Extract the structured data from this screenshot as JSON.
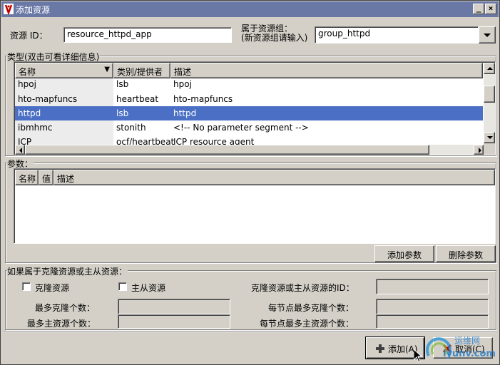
{
  "window": {
    "title": "添加资源",
    "min_glyph": "_",
    "max_glyph": "□",
    "close_glyph": "×",
    "title_bg": "#6a78a6"
  },
  "top": {
    "id_label": "资源 ID：",
    "id_value": "resource_httpd_app",
    "group_label_1": "属于资源组：",
    "group_label_2": "(新资源组请输入)",
    "group_value": "group_httpd"
  },
  "types": {
    "title": "类型(双击可看详细信息)",
    "columns": [
      "名称",
      "类别/提供者",
      "描述"
    ],
    "sort_arrow": "▼",
    "rows": [
      {
        "name": "hpoj",
        "class": "lsb",
        "desc": "hpoj"
      },
      {
        "name": "hto-mapfuncs",
        "class": "heartbeat",
        "desc": "hto-mapfuncs"
      },
      {
        "name": "httpd",
        "class": "lsb",
        "desc": "httpd",
        "selected": true
      },
      {
        "name": "ibmhmc",
        "class": "stonith",
        "desc": "<!-- No parameter segment -->"
      },
      {
        "name": "ICP",
        "class": "ocf/heartbeat",
        "desc": "ICP resource agent"
      }
    ],
    "selected_color": "#4a6fc4"
  },
  "params": {
    "title": "参数：",
    "columns": [
      "名称",
      "值",
      "描述"
    ],
    "add_button": "添加参数",
    "delete_button": "删除参数"
  },
  "clone": {
    "title": "如果属于克隆资源或主从资源：",
    "clone_checkbox": "克隆资源",
    "master_checkbox": "主从资源",
    "id_label": "克隆资源或主从资源的ID：",
    "max_clone_label": "最多克隆个数：",
    "max_master_label": "最多主资源个数：",
    "per_node_clone_label": "每节点最多克隆个数：",
    "per_node_master_label": "每节点最多主资源个数："
  },
  "footer": {
    "add_button": "添加(A)",
    "cancel_button": "取消(C)",
    "add_icon": "plus-icon",
    "cancel_icon": "x-icon"
  },
  "watermark": {
    "line1": "运维网",
    "line2": "iyunv.com"
  }
}
